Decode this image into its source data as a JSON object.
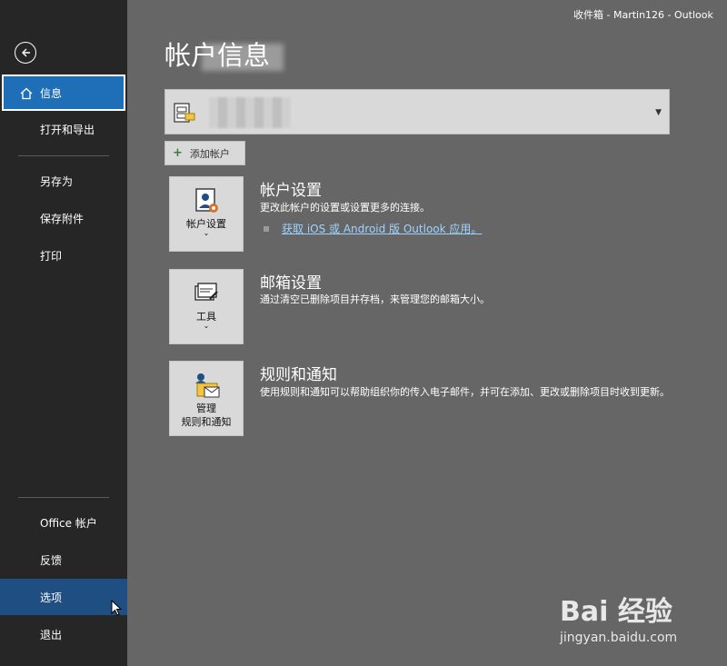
{
  "window": {
    "title": "收件箱 - Martin126   -  Outlook"
  },
  "sidebar": {
    "back_label": "返回",
    "items": [
      {
        "label": "信息"
      },
      {
        "label": "打开和导出"
      },
      {
        "label": "另存为"
      },
      {
        "label": "保存附件"
      },
      {
        "label": "打印"
      },
      {
        "label": "Office 帐户"
      },
      {
        "label": "反馈"
      },
      {
        "label": "选项"
      },
      {
        "label": "退出"
      }
    ]
  },
  "main": {
    "page_title": "帐户信息",
    "add_account_label": "添加帐户",
    "sections": [
      {
        "tile_label": "帐户设置",
        "heading": "帐户设置",
        "description": "更改此帐户的设置或设置更多的连接。",
        "link": "获取 iOS 或 Android 版 Outlook 应用。"
      },
      {
        "tile_label": "工具",
        "heading": "邮箱设置",
        "description": "通过清空已删除项目并存档，来管理您的邮箱大小。"
      },
      {
        "tile_label_line1": "管理",
        "tile_label_line2": "规则和通知",
        "heading": "规则和通知",
        "description": "使用规则和通知可以帮助组织你的传入电子邮件，并可在添加、更改或删除项目时收到更新。"
      }
    ]
  },
  "watermark": {
    "logo": "Bai 经验",
    "sub": "jingyan.baidu.com"
  },
  "colors": {
    "sidebar_bg": "#262626",
    "main_bg": "#666666",
    "accent": "#1f6fb8",
    "selected": "#1f4f82"
  }
}
